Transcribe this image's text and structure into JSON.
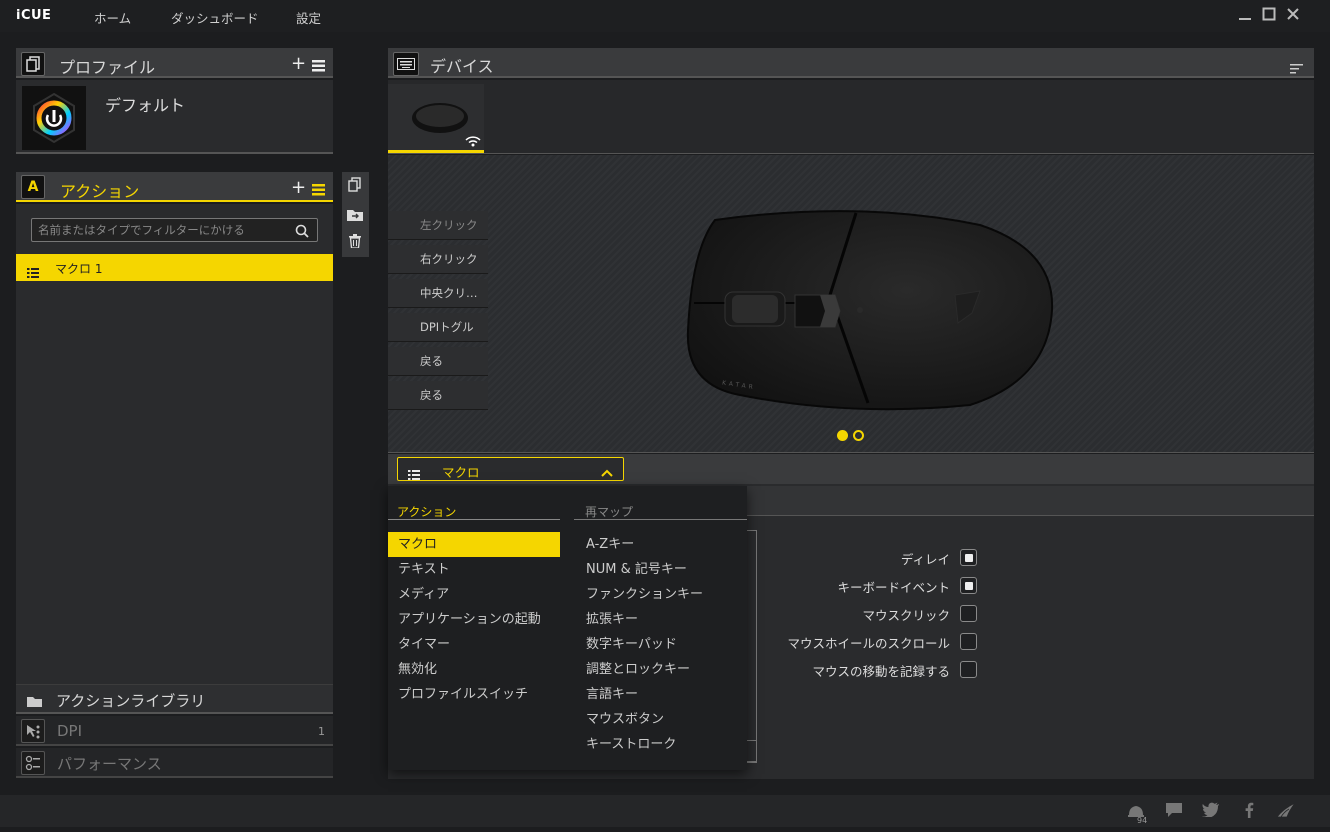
{
  "app": {
    "title": "iCUE"
  },
  "nav": {
    "home": "ホーム",
    "dashboard": "ダッシュボード",
    "settings": "設定"
  },
  "profiles": {
    "title": "プロファイル",
    "default_profile": "デフォルト"
  },
  "actions": {
    "title": "アクション",
    "filter_placeholder": "名前またはタイプでフィルターにかける",
    "items": [
      {
        "label": "マクロ 1"
      }
    ]
  },
  "library": {
    "title": "アクションライブラリ"
  },
  "dpi": {
    "title": "DPI",
    "value": "1"
  },
  "performance": {
    "title": "パフォーマンス"
  },
  "devices": {
    "title": "デバイス"
  },
  "buttons": [
    "左クリック",
    "右クリック",
    "中央クリ…",
    "DPIトグル",
    "戻る",
    "戻る"
  ],
  "mouse_text": "KATAR",
  "dropdown": {
    "selected": "マクロ"
  },
  "menu": {
    "actions_header": "アクション",
    "remap_header": "再マップ",
    "actions": [
      "マクロ",
      "テキスト",
      "メディア",
      "アプリケーションの起動",
      "タイマー",
      "無効化",
      "プロファイルスイッチ"
    ],
    "remap": [
      "A-Zキー",
      "NUM & 記号キー",
      "ファンクションキー",
      "拡張キー",
      "数字キーパッド",
      "調整とロックキー",
      "言語キー",
      "マウスボタン",
      "キーストローク"
    ]
  },
  "record_options": [
    {
      "label": "ディレイ",
      "checked": true
    },
    {
      "label": "キーボードイベント",
      "checked": true
    },
    {
      "label": "マウスクリック",
      "checked": false
    },
    {
      "label": "マウスホイールのスクロール",
      "checked": false
    },
    {
      "label": "マウスの移動を記録する",
      "checked": false
    }
  ],
  "footer": {
    "notification_count": "94"
  },
  "colors": {
    "accent": "#f5d600",
    "panel": "#2a2b2d",
    "header": "#3a3b3d"
  }
}
